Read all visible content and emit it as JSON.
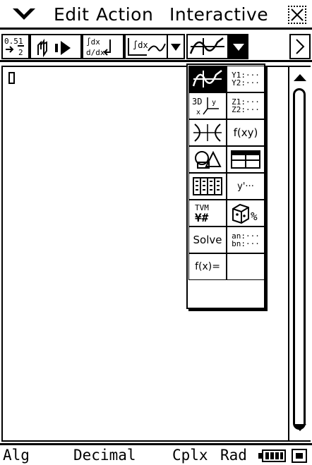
{
  "menubar": {
    "menu_icon": "chevron-down-icon",
    "items": [
      "Edit",
      "Action",
      "Interactive"
    ],
    "close_icon": "close-icon"
  },
  "toolbar": {
    "buttons": [
      "fraction-decimal-toggle-icon",
      "stylus-run-icon",
      "derivative-icon",
      "integral-graph-icon",
      "dropdown-arrow-icon",
      "graph-editor-icon",
      "dropdown-arrow-icon",
      "scroll-right-icon"
    ]
  },
  "palette": {
    "cells": [
      {
        "icon": "graph-window-icon",
        "selected": true
      },
      {
        "text": "Y1:···\nY2:···"
      },
      {
        "text": "3D graph"
      },
      {
        "text": "Z1:···\nZ2:···"
      },
      {
        "icon": "conics-icon"
      },
      {
        "text": "f(xy)"
      },
      {
        "icon": "geometry-icon"
      },
      {
        "icon": "spreadsheet-icon"
      },
      {
        "icon": "stat-list-icon"
      },
      {
        "text": "y'···"
      },
      {
        "icon": "financial-icon"
      },
      {
        "icon": "probability-icon"
      },
      {
        "text": "Solve"
      },
      {
        "text": "an:···\nbn:···"
      },
      {
        "text": "f(x)="
      },
      {
        "text": ""
      }
    ]
  },
  "status": {
    "mode1": "Alg",
    "mode2": "Decimal",
    "mode3": "Cplx",
    "mode4": "Rad",
    "battery_icon": "battery-icon",
    "keyboard_icon": "keyboard-toggle-icon"
  }
}
